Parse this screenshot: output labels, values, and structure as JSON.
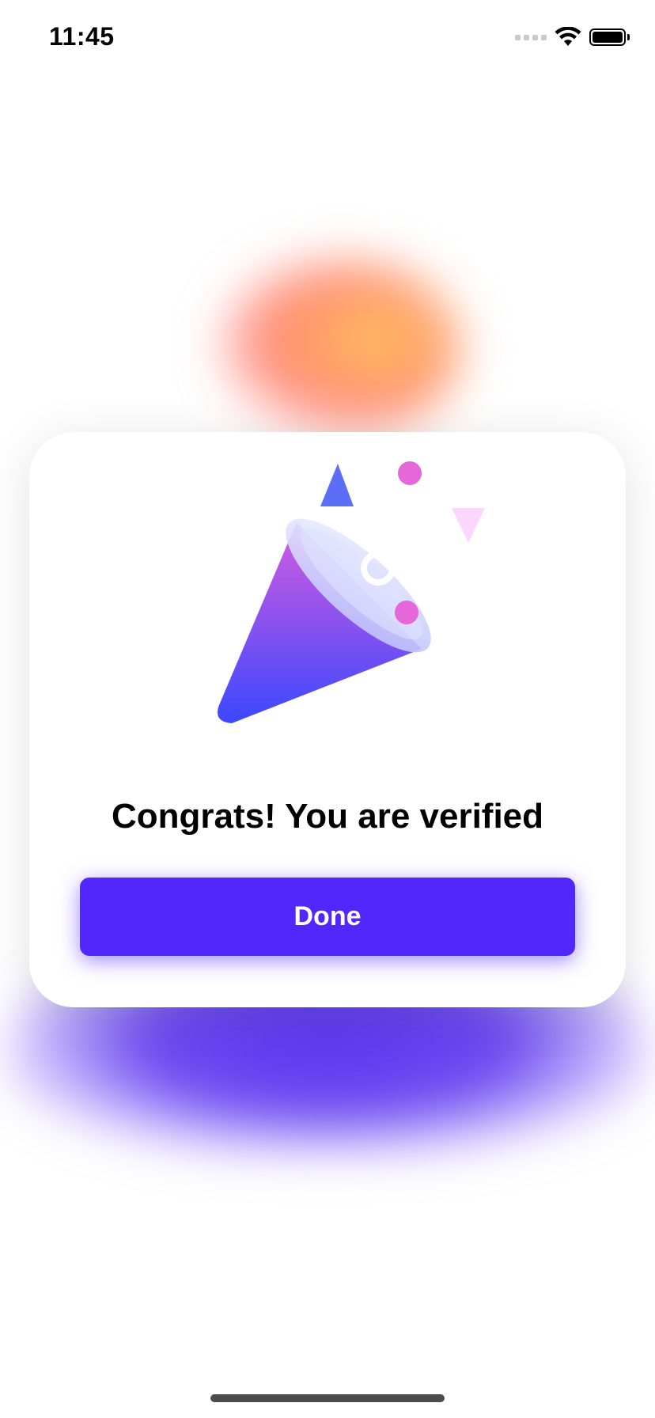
{
  "status_bar": {
    "time": "11:45"
  },
  "icons": {
    "wifi": "wifi-icon",
    "battery": "battery-icon",
    "signal": "cellular-signal-icon",
    "illustration": "party-popper-icon"
  },
  "dialog": {
    "title": "Congrats! You are verified",
    "done_label": "Done"
  },
  "colors": {
    "primary_button": "#5127fb",
    "cone_top": "#d35ee0",
    "cone_bottom": "#3b48ff",
    "confetti_pink": "#e667da",
    "confetti_blue": "#5b6ef5"
  }
}
